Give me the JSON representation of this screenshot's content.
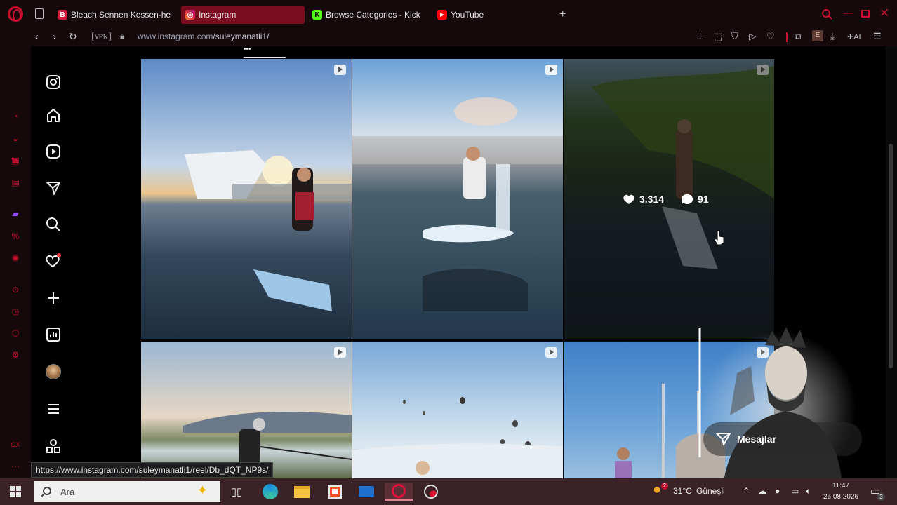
{
  "browser": {
    "tabs": [
      {
        "label": "Bleach Sennen Kessen-hen",
        "favicon_color": "#d11a3a",
        "favicon_glyph": "B"
      },
      {
        "label": "Instagram",
        "favicon_color": "#e1306c",
        "favicon_glyph": "◎"
      },
      {
        "label": "Browse Categories - Kick",
        "favicon_color": "#53fc18",
        "favicon_glyph": "K"
      },
      {
        "label": "YouTube",
        "favicon_color": "#ff0000",
        "favicon_glyph": "▶"
      }
    ],
    "vpn_label": "VPN",
    "url_host": "www.instagram.com",
    "url_path": "/suleymanatli1/",
    "extension_letter": "E",
    "ai_label": "AI",
    "accent": "#c8102e"
  },
  "instagram": {
    "nav": [
      "instagram-logo",
      "home",
      "reels",
      "direct",
      "search",
      "notifications",
      "create",
      "dashboard",
      "profile",
      "more",
      "threads"
    ],
    "hovered_post": {
      "likes": "3.314",
      "comments": "91"
    },
    "status_url": "https://www.instagram.com/suleymanatli1/reel/Db_dQT_NP9s/",
    "messages_label": "Mesajlar"
  },
  "taskbar": {
    "search_placeholder": "Ara",
    "weather": "31°C",
    "weather_desc": "Güneşli",
    "weather_badge": "2",
    "time": "11:47",
    "date": "26.08.2026",
    "notification_count": "3"
  }
}
